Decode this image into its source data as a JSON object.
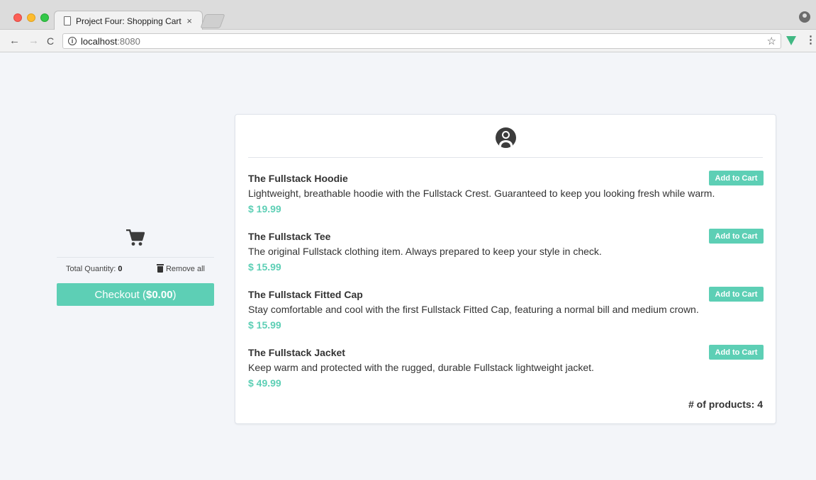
{
  "browser": {
    "tab_title": "Project Four: Shopping Cart",
    "tab_close": "×",
    "url_host": "localhost",
    "url_port": ":8080",
    "back_icon": "←",
    "forward_icon": "→",
    "reload_icon": "C",
    "info_icon": "i",
    "star_icon": "☆",
    "menu_icon": "⋮"
  },
  "cart": {
    "total_quantity_label": "Total Quantity:",
    "total_quantity_value": "0",
    "remove_all_label": "Remove all",
    "checkout_label": "Checkout (",
    "checkout_amount": "$0.00",
    "checkout_close": ")"
  },
  "products": [
    {
      "name": "The Fullstack Hoodie",
      "description": "Lightweight, breathable hoodie with the Fullstack Crest. Guaranteed to keep you looking fresh while warm.",
      "price": "$ 19.99",
      "button": "Add to Cart"
    },
    {
      "name": "The Fullstack Tee",
      "description": "The original Fullstack clothing item. Always prepared to keep your style in check.",
      "price": "$ 15.99",
      "button": "Add to Cart"
    },
    {
      "name": "The Fullstack Fitted Cap",
      "description": "Stay comfortable and cool with the first Fullstack Fitted Cap, featuring a normal bill and medium crown.",
      "price": "$ 15.99",
      "button": "Add to Cart"
    },
    {
      "name": "The Fullstack Jacket",
      "description": "Keep warm and protected with the rugged, durable Fullstack lightweight jacket.",
      "price": "$ 49.99",
      "button": "Add to Cart"
    }
  ],
  "product_count_label": "# of products: 4",
  "colors": {
    "accent": "#5dcfb5",
    "page_background": "#f3f5f9",
    "text": "#333333"
  }
}
